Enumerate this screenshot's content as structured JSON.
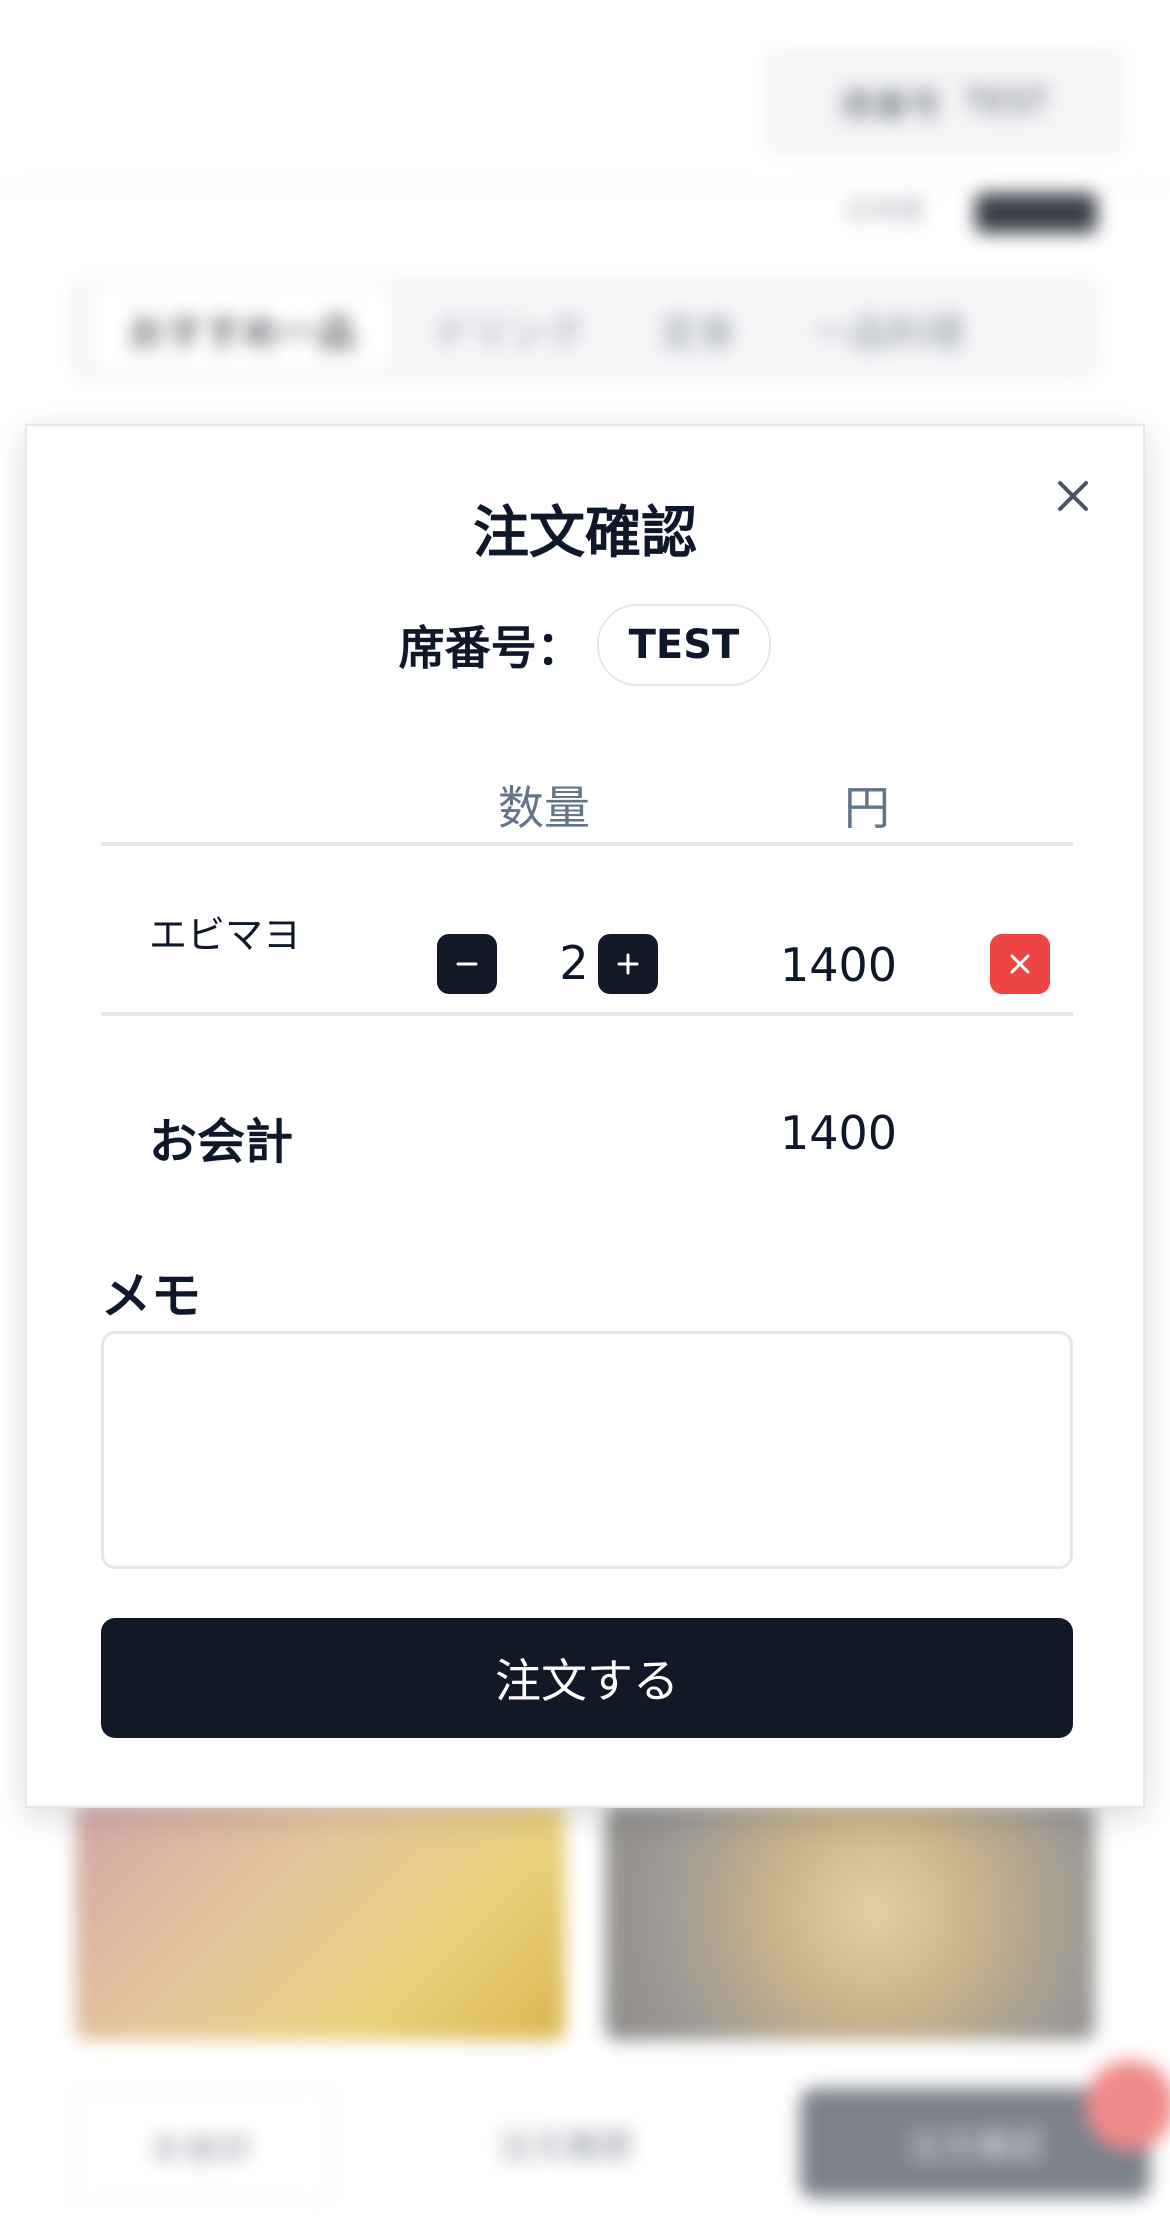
{
  "background": {
    "seat_chip": {
      "label": "席番号",
      "value": "TEST"
    },
    "language": "日本語",
    "tabs": [
      "おすすめ一品",
      "ドリンク",
      "定食",
      "一品料理"
    ],
    "bottom_nav": [
      "お会計",
      "注文履歴",
      "注文確認"
    ]
  },
  "modal": {
    "title": "注文確認",
    "seat_label": "席番号：",
    "seat_value": "TEST",
    "columns": {
      "qty": "数量",
      "yen": "円"
    },
    "items": [
      {
        "name": "エビマヨ",
        "qty": "2",
        "price": "1400"
      }
    ],
    "total_label": "お会計",
    "total_value": "1400",
    "memo_label": "メモ",
    "memo_value": "",
    "submit_label": "注文する"
  },
  "colors": {
    "primary": "#111827",
    "danger": "#ef4444",
    "muted_text": "#64748b",
    "border": "#e2e8f0"
  }
}
